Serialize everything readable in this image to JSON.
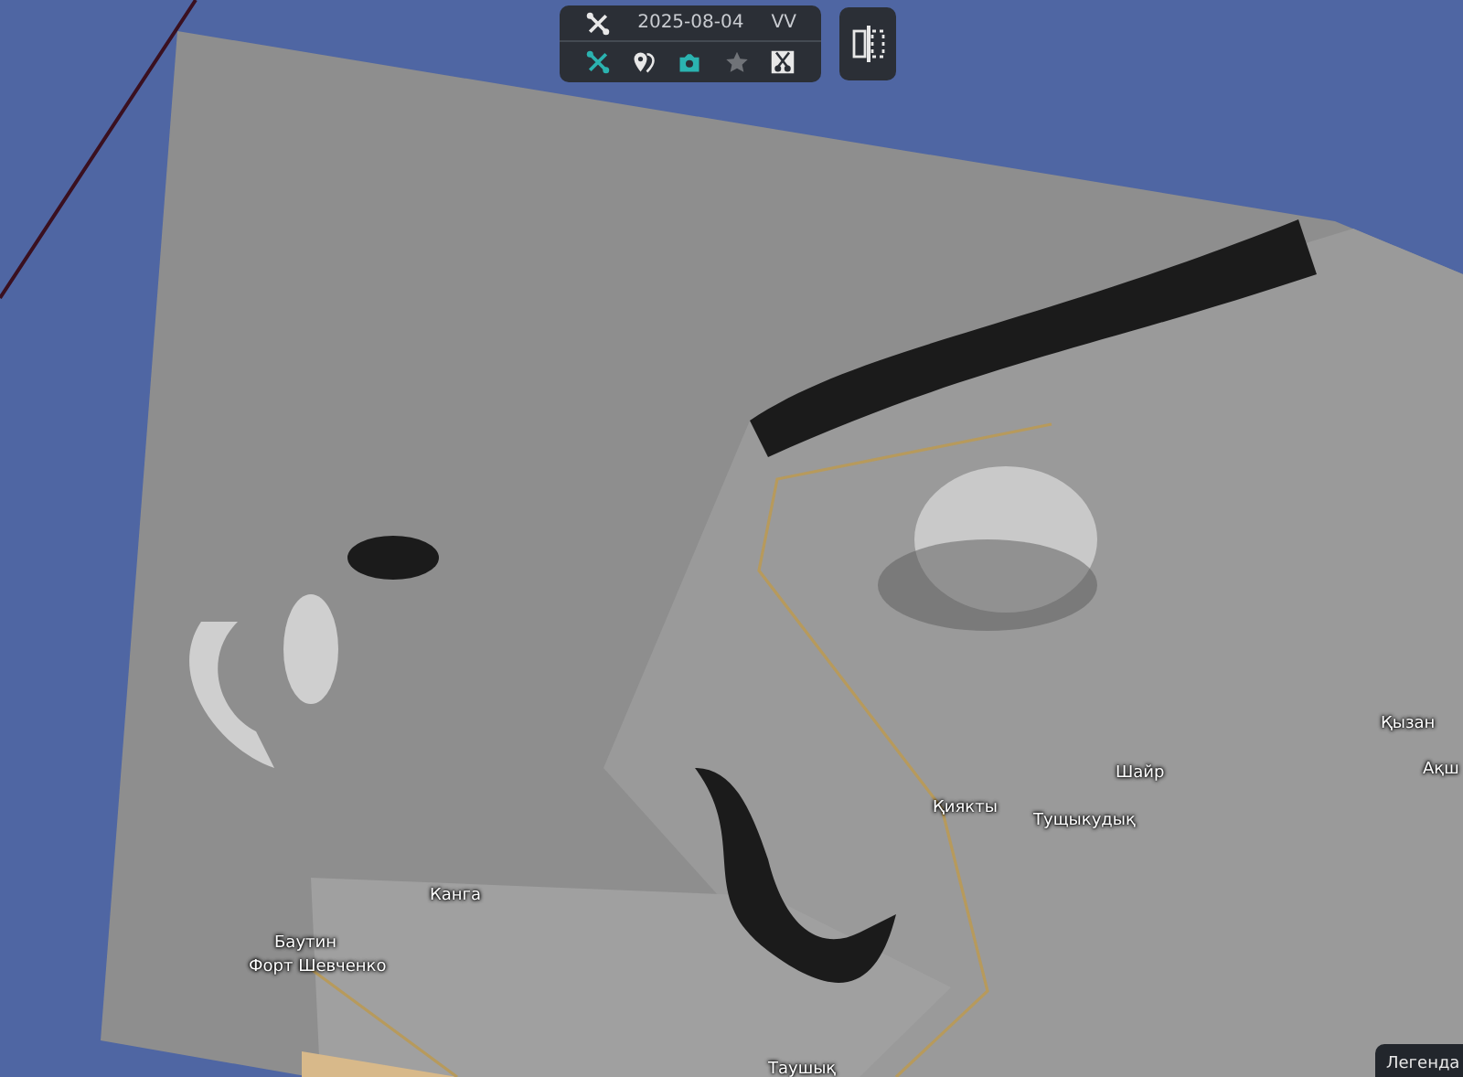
{
  "toolbar": {
    "top_tool": {
      "kind": "tools"
    },
    "date": "2025-08-04",
    "polarization": "VV",
    "tools": [
      {
        "kind": "tools",
        "on": true,
        "disabled": false
      },
      {
        "kind": "pins",
        "on": false,
        "disabled": false
      },
      {
        "kind": "camera",
        "on": true,
        "disabled": false
      },
      {
        "kind": "star",
        "on": false,
        "disabled": true
      },
      {
        "kind": "scissors",
        "on": false,
        "disabled": false
      }
    ]
  },
  "compare_button": {
    "kind": "split"
  },
  "map_labels": [
    "Қызан",
    "Ақш",
    "Шайр",
    "Қиякты",
    "Тущыкудық",
    "Канга",
    "Баутин",
    "Форт Шевченко",
    "Таушық"
  ],
  "legend": {
    "label": "Легенда"
  }
}
